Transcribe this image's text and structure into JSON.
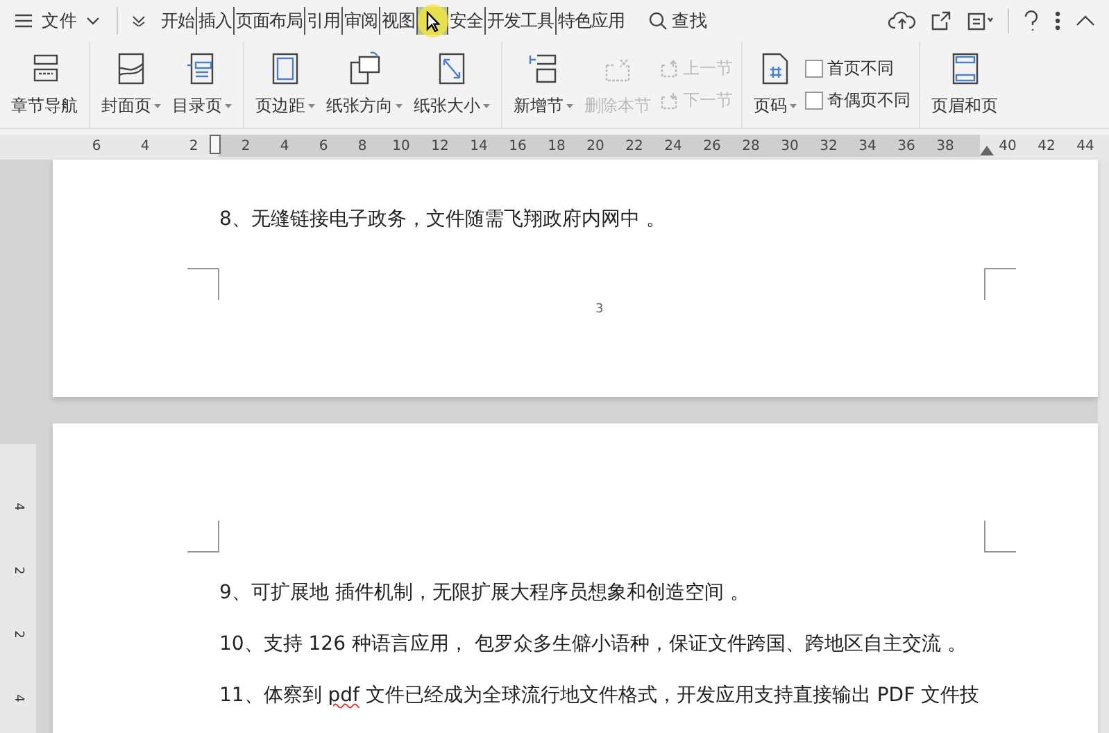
{
  "menu_bar": {
    "file_label": "文件",
    "tabs": [
      {
        "label": "开始",
        "selected": false
      },
      {
        "label": "插入",
        "selected": false
      },
      {
        "label": "页面布局",
        "selected": false
      },
      {
        "label": "引用",
        "selected": false
      },
      {
        "label": "审阅",
        "selected": false
      },
      {
        "label": "视图",
        "selected": false
      },
      {
        "selected": true
      },
      {
        "label": "安全",
        "selected": false
      },
      {
        "label": "开发工具",
        "selected": false
      },
      {
        "label": "特色应用",
        "selected": false
      }
    ],
    "search_label": "查找"
  },
  "ribbon": {
    "groups": [
      {
        "columns": [
          [
            {
              "kind": "large",
              "label": "章节导航",
              "dropdown": false,
              "disabled": false
            }
          ]
        ]
      },
      {
        "columns": [
          [
            {
              "kind": "large",
              "label": "封面页",
              "dropdown": true,
              "disabled": false
            }
          ],
          [
            {
              "kind": "large",
              "label": "目录页",
              "dropdown": true,
              "disabled": false
            }
          ]
        ]
      },
      {
        "columns": [
          [
            {
              "kind": "large",
              "label": "页边距",
              "dropdown": true,
              "disabled": false
            }
          ],
          [
            {
              "kind": "large",
              "label": "纸张方向",
              "dropdown": true,
              "disabled": false
            }
          ],
          [
            {
              "kind": "large",
              "label": "纸张大小",
              "dropdown": true,
              "disabled": false
            }
          ]
        ]
      },
      {
        "columns": [
          [
            {
              "kind": "large",
              "label": "新增节",
              "dropdown": true,
              "disabled": false
            }
          ],
          [
            {
              "kind": "large",
              "label": "删除本节",
              "dropdown": false,
              "disabled": true
            }
          ],
          [
            {
              "kind": "small",
              "label": "上一节",
              "disabled": true
            },
            {
              "kind": "small",
              "label": "下一节",
              "disabled": true
            }
          ]
        ]
      },
      {
        "columns": [
          [
            {
              "kind": "large",
              "label": "页码",
              "dropdown": true,
              "disabled": false
            }
          ],
          [
            {
              "kind": "checkbox",
              "label": "首页不同",
              "checked": false
            },
            {
              "kind": "checkbox",
              "label": "奇偶页不同",
              "checked": false
            }
          ]
        ]
      },
      {
        "columns": [
          [
            {
              "kind": "large",
              "label": "页眉和页",
              "dropdown": false,
              "disabled": false
            }
          ]
        ]
      }
    ]
  },
  "ruler": {
    "left_numbers": [
      "6",
      "4",
      "2"
    ],
    "body_numbers": [
      "2",
      "4",
      "6",
      "8",
      "10",
      "12",
      "14",
      "16",
      "18",
      "20",
      "22",
      "24",
      "26",
      "28",
      "30",
      "32",
      "34",
      "36",
      "38"
    ],
    "right_numbers": [
      "40",
      "42",
      "44"
    ]
  },
  "vertical_ruler": [
    "4",
    "2",
    "2",
    "4"
  ],
  "pages": [
    {
      "paragraphs": [
        [
          {
            "text": "8、无缝链接电子政务，文件随需飞翔政府内网中 。"
          }
        ]
      ],
      "page_number": "3"
    },
    {
      "paragraphs": [
        [
          {
            "text": "9、可扩展地  插件机制，无限扩展大程序员想象和创造空间  。"
          }
        ],
        [
          {
            "text": "10、支持 126 种语言应用，  包罗众多生僻小语种，保证文件跨国、跨地区自主交流  。"
          }
        ],
        [
          {
            "text": "11、体察到  "
          },
          {
            "text": "pdf",
            "misspelled": true
          },
          {
            "text": " 文件已经成为全球流行地文件格式，开发应用支持直接输出  PDF 文件技"
          }
        ]
      ]
    }
  ]
}
